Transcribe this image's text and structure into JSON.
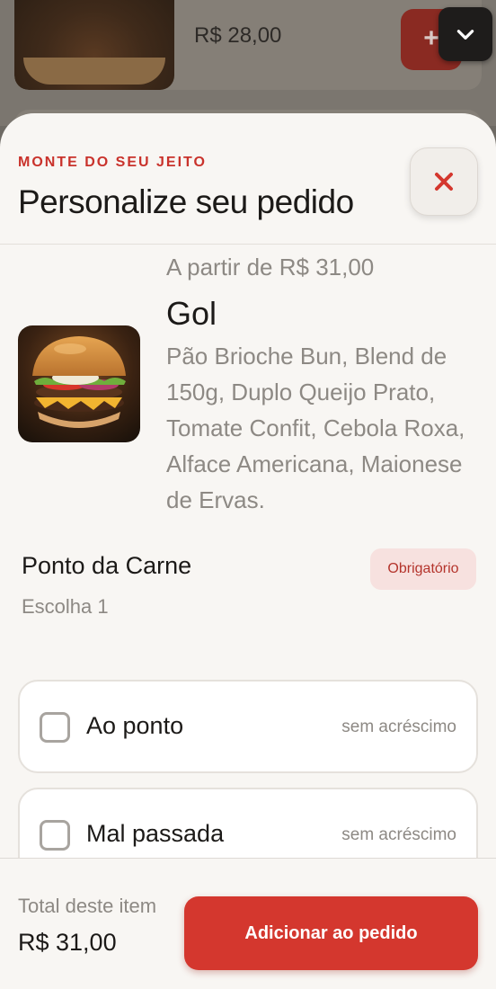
{
  "background": {
    "item_price": "R$ 28,00",
    "add_symbol": "+"
  },
  "sheet": {
    "eyebrow": "MONTE DO SEU JEITO",
    "title": "Personalize seu pedido"
  },
  "product": {
    "price_from": "A partir de R$ 31,00",
    "name": "Gol",
    "description": "Pão Brioche Bun, Blend de 150g, Duplo Queijo Prato, Tomate Confit, Cebola Roxa, Alface Americana, Maionese de Ervas."
  },
  "option_group": {
    "title": "Ponto da Carne",
    "subtitle": "Escolha 1",
    "badge": "Obrigatório",
    "options": [
      {
        "label": "Ao ponto",
        "price": "sem acréscimo",
        "checked": false
      },
      {
        "label": "Mal passada",
        "price": "sem acréscimo",
        "checked": false
      }
    ]
  },
  "footer": {
    "total_label": "Total deste item",
    "total_value": "R$ 31,00",
    "add_button": "Adicionar ao pedido"
  },
  "colors": {
    "accent": "#d4372e",
    "eyebrow": "#c9322b",
    "badge_bg": "#f7e1df",
    "sheet_bg": "#f8f6f3"
  },
  "icons": [
    "chevron-down-icon",
    "close-icon",
    "plus-icon",
    "checkbox-icon"
  ]
}
